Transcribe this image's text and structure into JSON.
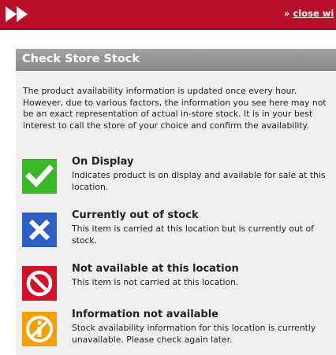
{
  "header": {
    "close_arrow": "»",
    "close_label": "close wi"
  },
  "panel": {
    "title": "Check Store Stock",
    "intro": "The product availability information is updated once every hour. However, due to various factors, the information you see here may not be an exact representation of actual in-store stock. It is in your best interest to call the store of your choice and confirm the availability.",
    "legend": [
      {
        "icon": "checkmark-icon",
        "color": "#3cb728",
        "title": "On Display",
        "description": "Indicates product is on display and available for sale at this location."
      },
      {
        "icon": "x-icon",
        "color": "#2f5fc4",
        "title": "Currently out of stock",
        "description": "This item is carried at this location but is currently out of stock."
      },
      {
        "icon": "prohibited-icon",
        "color": "#d4102a",
        "title": "Not available at this location",
        "description": "This item is not carried at this location."
      },
      {
        "icon": "info-icon",
        "color": "#f5a000",
        "title": "Information not available",
        "description": "Stock availability information for this location is currently unavailable. Please check again later."
      }
    ]
  },
  "colors": {
    "brand_red": "#b8102a",
    "panel_bg": "#f0f0f0",
    "header_gray": "#999999"
  }
}
